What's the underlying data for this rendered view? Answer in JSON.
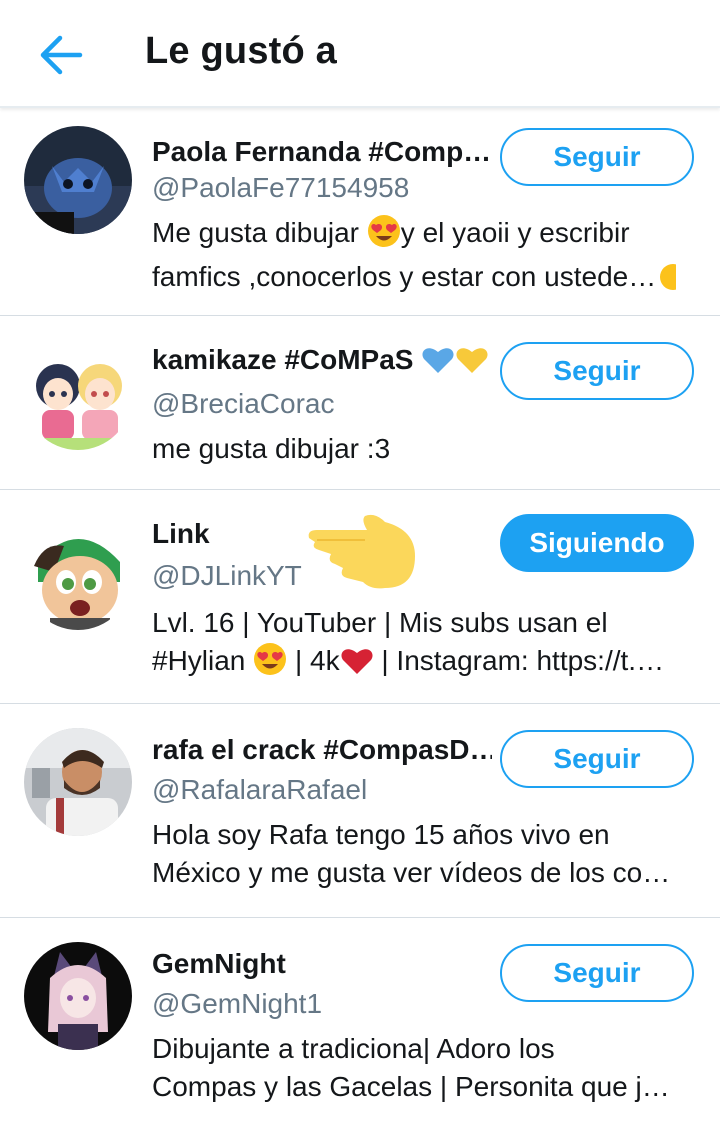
{
  "header": {
    "title": "Le gustó a",
    "back_icon": "arrow-left-icon",
    "accent": "#1da1f2"
  },
  "users": [
    {
      "name": "Paola Fernanda #Comp…",
      "handle": "@PaolaFe77154958",
      "bio_line1_a": "Me gusta dibujar ",
      "bio_line1_b": "y  el yaoii y escribir",
      "bio_line2": "famfics ,conocerlos y estar con ustede…",
      "button": "Seguir",
      "following": false
    },
    {
      "name": "kamikaze #CoMPaS ",
      "handle": "@BreciaCorac",
      "bio_line1": "me gusta dibujar :3",
      "button": "Seguir",
      "following": false
    },
    {
      "name": "Link",
      "handle": "@DJLinkYT",
      "bio_line1": "Lvl. 16 | YouTuber | Mis subs usan el",
      "bio_line2_a": "#Hylian ",
      "bio_line2_b": " | 4k",
      "bio_line2_c": " | Instagram: https://t.…",
      "button": "Siguiendo",
      "following": true
    },
    {
      "name": "rafa el crack #CompasD…",
      "handle": "@RafalaraRafael",
      "bio_line1": "Hola soy Rafa tengo 15 años vivo en",
      "bio_line2": "México y me gusta ver vídeos de los co…",
      "button": "Seguir",
      "following": false
    },
    {
      "name": "GemNight",
      "handle": "@GemNight1",
      "bio_line1": "Dibujante a tradiciona| Adoro los",
      "bio_line2": "Compas y las Gacelas | Personita que j…",
      "button": "Seguir",
      "following": false
    }
  ]
}
